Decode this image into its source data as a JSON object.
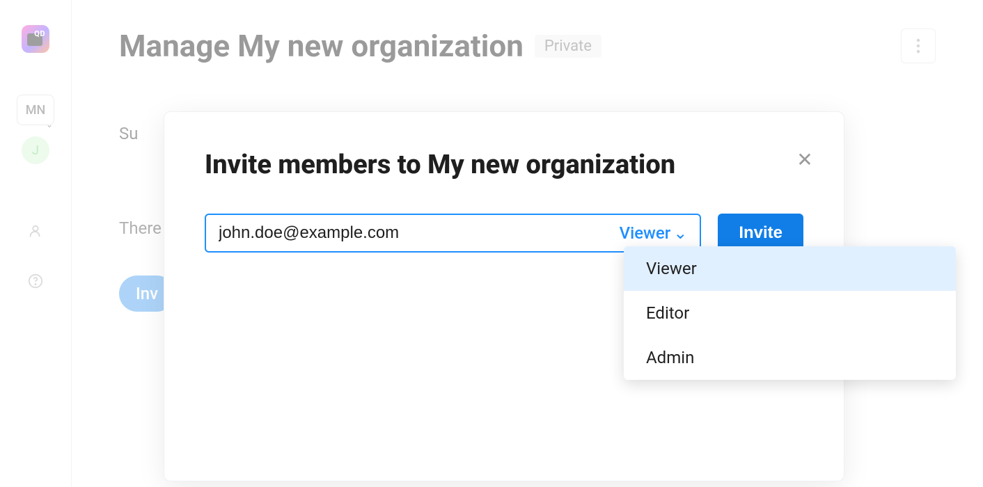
{
  "sidebar": {
    "org_initials": "MN",
    "avatar_initial": "J"
  },
  "page": {
    "title": "Manage My new organization",
    "visibility_label": "Private",
    "subnav_visible_prefix": "Su",
    "empty_text_visible": "There",
    "invite_button_visible": "Inv"
  },
  "modal": {
    "title": "Invite members to My new organization",
    "email_value": "john.doe@example.com",
    "role_selected": "Viewer",
    "invite_button": "Invite",
    "role_options": [
      "Viewer",
      "Editor",
      "Admin"
    ]
  }
}
